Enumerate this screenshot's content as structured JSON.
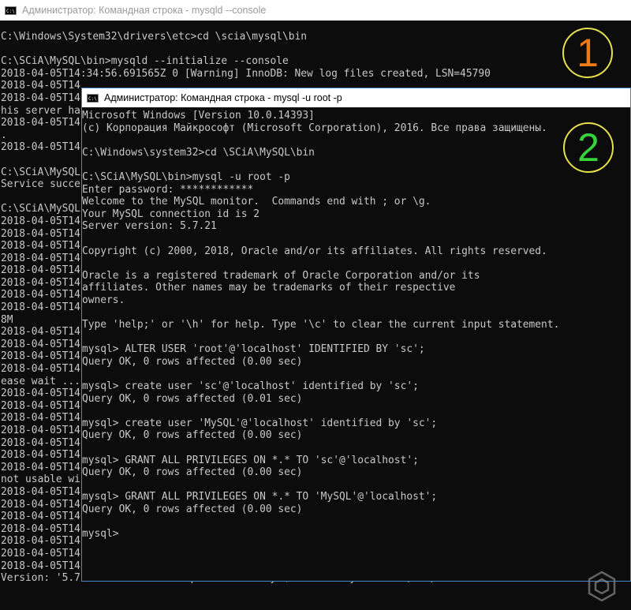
{
  "window1": {
    "title": "Администратор: Командная строка - mysqld  --console",
    "icon_label": "C:\\",
    "lines": [
      "C:\\Windows\\System32\\drivers\\etc>cd \\scia\\mysql\\bin",
      "",
      "C:\\SCiA\\MySQL\\bin>mysqld --initialize --console",
      "2018-04-05T14:34:56.691565Z 0 [Warning] InnoDB: New log files created, LSN=45790",
      "2018-04-05T14",
      "2018-04-05T14",
      "his server ha",
      "2018-04-05T14",
      ".",
      "2018-04-05T14",
      "",
      "C:\\SCiA\\MySQL",
      "Service succe",
      "",
      "C:\\SCiA\\MySQL",
      "2018-04-05T14",
      "2018-04-05T14",
      "2018-04-05T14",
      "2018-04-05T14",
      "2018-04-05T14",
      "2018-04-05T14",
      "2018-04-05T14",
      "2018-04-05T14",
      "8M",
      "2018-04-05T14",
      "2018-04-05T14",
      "2018-04-05T14",
      "2018-04-05T14",
      "ease wait ...",
      "2018-04-05T14",
      "2018-04-05T14",
      "2018-04-05T14",
      "2018-04-05T14",
      "2018-04-05T14",
      "2018-04-05T14",
      "2018-04-05T14",
      "not usable wi",
      "2018-04-05T14",
      "2018-04-05T14",
      "2018-04-05T14",
      "2018-04-05T14",
      "2018-04-05T14",
      "2018-04-05T14",
      "2018-04-05T14",
      "Version: '5.7.21'  socket: ''  port: 3306  MySQL Community Server (GPL)"
    ]
  },
  "window2": {
    "title": "Администратор: Командная строка - mysql  -u root -p",
    "icon_label": "C:\\",
    "lines": [
      "Microsoft Windows [Version 10.0.14393]",
      "(c) Корпорация Майкрософт (Microsoft Corporation), 2016. Все права защищены.",
      "",
      "C:\\Windows\\system32>cd \\SCiA\\MySQL\\bin",
      "",
      "C:\\SCiA\\MySQL\\bin>mysql -u root -p",
      "Enter password: ************",
      "Welcome to the MySQL monitor.  Commands end with ; or \\g.",
      "Your MySQL connection id is 2",
      "Server version: 5.7.21",
      "",
      "Copyright (c) 2000, 2018, Oracle and/or its affiliates. All rights reserved.",
      "",
      "Oracle is a registered trademark of Oracle Corporation and/or its",
      "affiliates. Other names may be trademarks of their respective",
      "owners.",
      "",
      "Type 'help;' or '\\h' for help. Type '\\c' to clear the current input statement.",
      "",
      "mysql> ALTER USER 'root'@'localhost' IDENTIFIED BY 'sc';",
      "Query OK, 0 rows affected (0.00 sec)",
      "",
      "mysql> create user 'sc'@'localhost' identified by 'sc';",
      "Query OK, 0 rows affected (0.01 sec)",
      "",
      "mysql> create user 'MySQL'@'localhost' identified by 'sc';",
      "Query OK, 0 rows affected (0.00 sec)",
      "",
      "mysql> GRANT ALL PRIVILEGES ON *.* TO 'sc'@'localhost';",
      "Query OK, 0 rows affected (0.00 sec)",
      "",
      "mysql> GRANT ALL PRIVILEGES ON *.* TO 'MySQL'@'localhost';",
      "Query OK, 0 rows affected (0.00 sec)",
      "",
      "mysql>"
    ]
  },
  "badges": {
    "first": "1",
    "second": "2",
    "first_color": "#f07a1a",
    "second_color": "#38d23a",
    "ring_color": "#e8e04a"
  },
  "logo": {
    "icon": "hexagon-logo-icon"
  }
}
